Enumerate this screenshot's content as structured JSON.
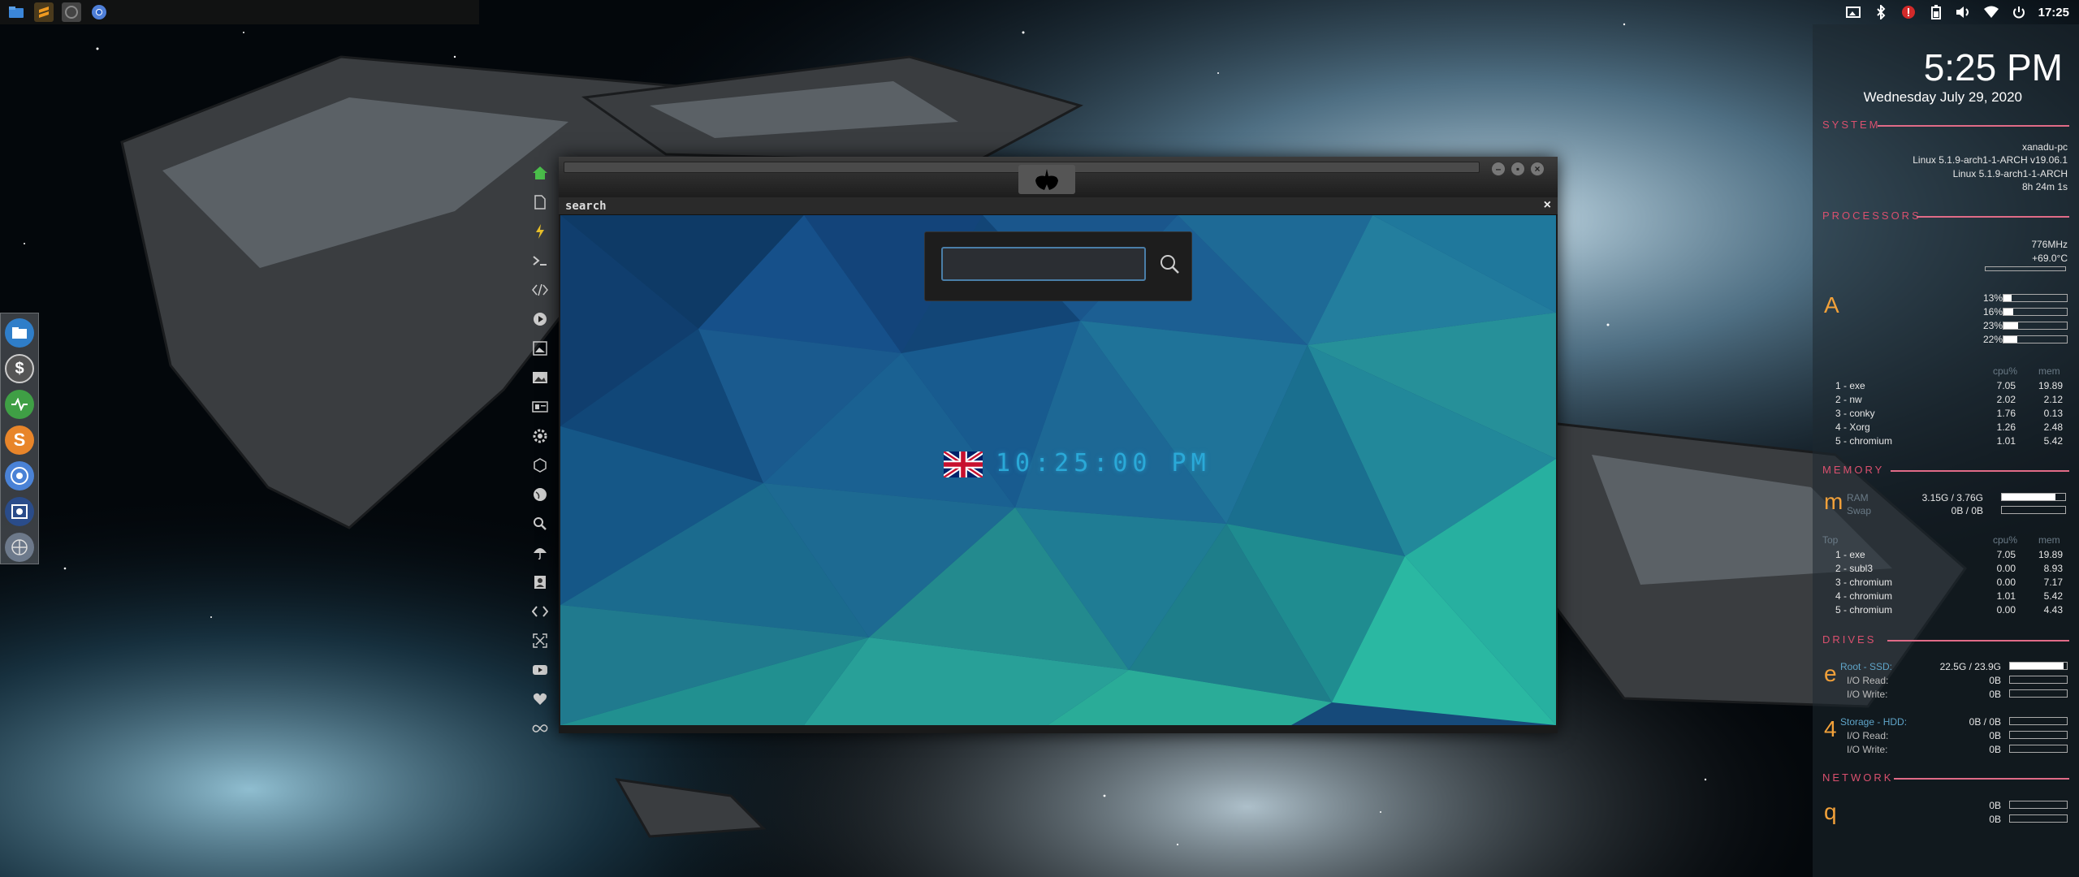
{
  "colors": {
    "accent": "#d9506e",
    "conky_letters": "#f2a13a",
    "clock_digits": "#2aa9d8"
  },
  "top_panel": {
    "taskbar": [
      {
        "name": "file-manager-icon"
      },
      {
        "name": "sublime-text-icon"
      },
      {
        "name": "app-icon"
      },
      {
        "name": "chromium-icon"
      }
    ],
    "tray": {
      "time": "17:25"
    }
  },
  "dock": [
    {
      "name": "file-manager-icon"
    },
    {
      "name": "dollar-icon"
    },
    {
      "name": "activity-monitor-icon"
    },
    {
      "name": "sublime-icon"
    },
    {
      "name": "chromium-icon"
    },
    {
      "name": "screenshot-icon"
    },
    {
      "name": "network-icon"
    }
  ],
  "window": {
    "tab_title": "search",
    "tab_close": "×",
    "search": {
      "value": "",
      "placeholder": ""
    },
    "clock": "10:25:00 PM"
  },
  "conky": {
    "time": "5:25 PM",
    "date": "Wednesday July 29, 2020",
    "system": {
      "title": "SYSTEM",
      "hostname": "xanadu-pc",
      "line2": "Linux 5.1.9-arch1-1-ARCH v19.06.1",
      "line3": "Linux 5.1.9-arch1-1-ARCH",
      "uptime": "8h 24m 1s"
    },
    "processors": {
      "title": "PROCESSORS",
      "freq": "776MHz",
      "temp": "+69.0°C",
      "letter": "A",
      "cores": [
        {
          "pct": "13%",
          "val": 0.13
        },
        {
          "pct": "16%",
          "val": 0.16
        },
        {
          "pct": "23%",
          "val": 0.23
        },
        {
          "pct": "22%",
          "val": 0.22
        }
      ],
      "head_cpu": "cpu%",
      "head_mem": "mem",
      "top": [
        {
          "name": "1 - exe",
          "cpu": "7.05",
          "mem": "19.89"
        },
        {
          "name": "2 - nw",
          "cpu": "2.02",
          "mem": "2.12"
        },
        {
          "name": "3 - conky",
          "cpu": "1.76",
          "mem": "0.13"
        },
        {
          "name": "4 - Xorg",
          "cpu": "1.26",
          "mem": "2.48"
        },
        {
          "name": "5 - chromium",
          "cpu": "1.01",
          "mem": "5.42"
        }
      ]
    },
    "memory": {
      "title": "MEMORY",
      "letter": "m",
      "ram_label": "RAM",
      "ram": "3.15G / 3.76G",
      "ram_val": 0.84,
      "swap_label": "Swap",
      "swap": "0B / 0B",
      "top_label": "Top",
      "head_cpu": "cpu%",
      "head_mem": "mem",
      "top": [
        {
          "name": "1 - exe",
          "cpu": "7.05",
          "mem": "19.89"
        },
        {
          "name": "2 - subl3",
          "cpu": "0.00",
          "mem": "8.93"
        },
        {
          "name": "3 - chromium",
          "cpu": "0.00",
          "mem": "7.17"
        },
        {
          "name": "4 - chromium",
          "cpu": "1.01",
          "mem": "5.42"
        },
        {
          "name": "5 - chromium",
          "cpu": "0.00",
          "mem": "4.43"
        }
      ]
    },
    "drives": {
      "title": "DRIVES",
      "root": {
        "letter": "e",
        "label": "Root - SSD:",
        "value": "22.5G / 23.9G",
        "val": 0.94,
        "read_label": "I/O Read:",
        "read": "0B",
        "write_label": "I/O Write:",
        "write": "0B"
      },
      "storage": {
        "letter": "4",
        "label": "Storage - HDD:",
        "value": "0B / 0B",
        "val": 0,
        "read_label": "I/O Read:",
        "read": "0B",
        "write_label": "I/O Write:",
        "write": "0B"
      }
    },
    "network": {
      "title": "NETWORK",
      "letter": "q",
      "down": "0B",
      "up": "0B"
    }
  }
}
